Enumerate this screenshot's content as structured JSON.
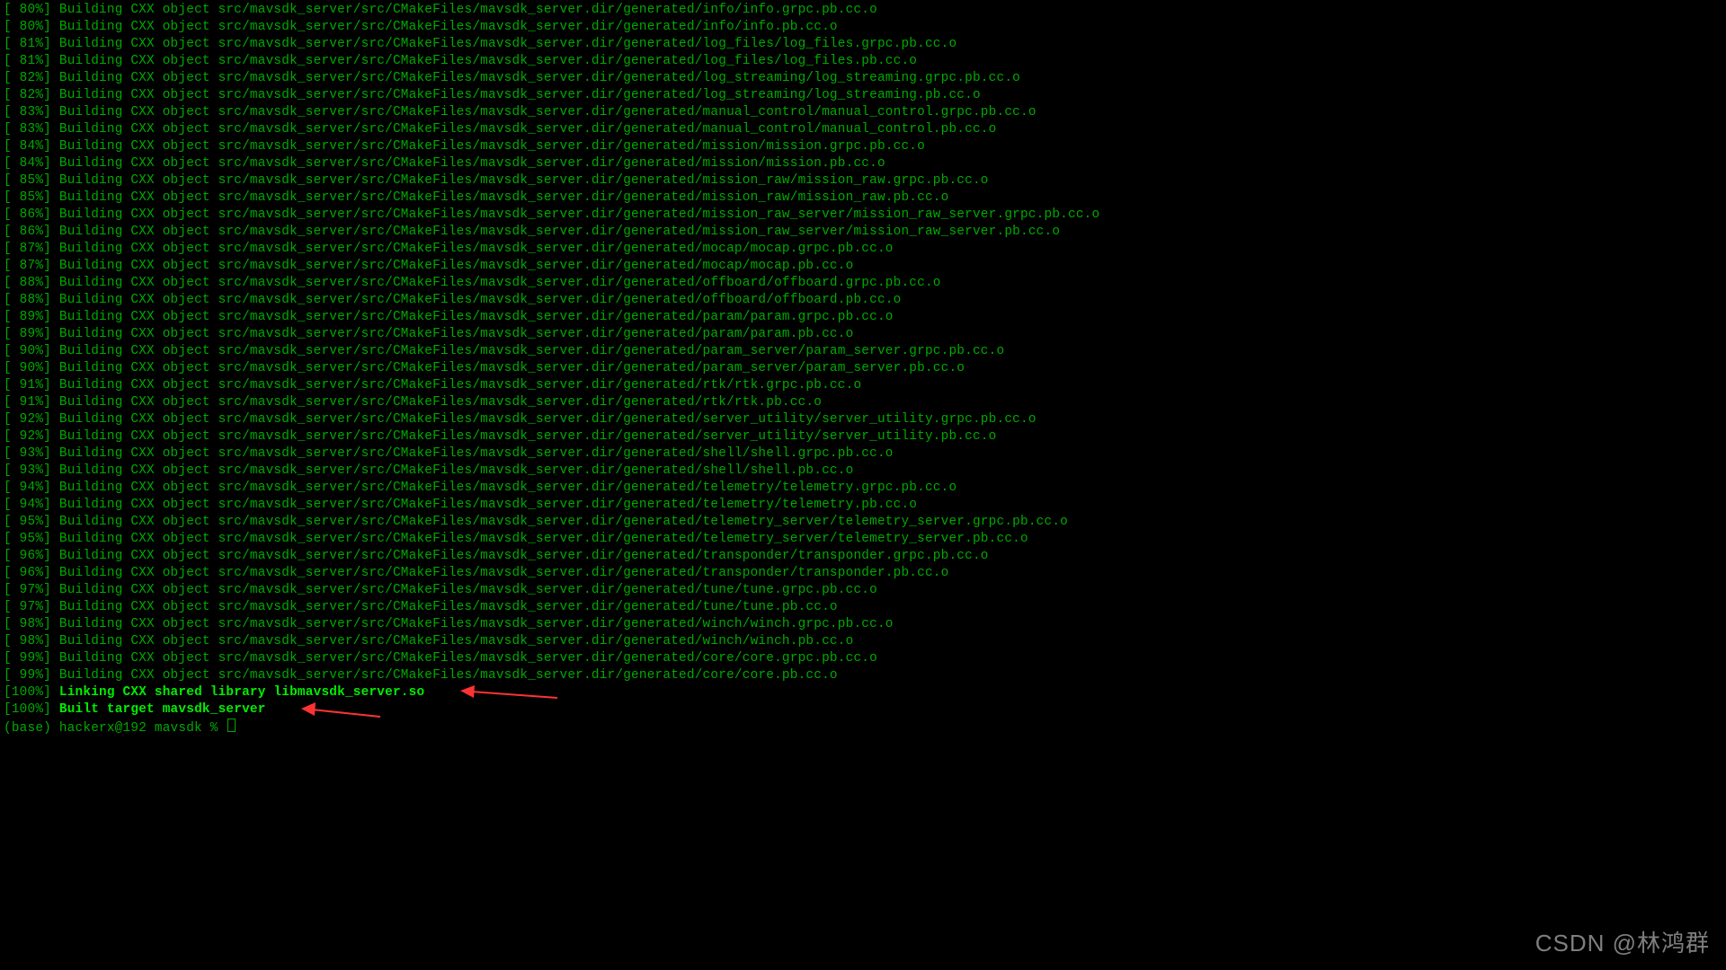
{
  "watermark": "CSDN @林鸿群",
  "prompt": {
    "env": "(base)",
    "user_host": "hackerx@192",
    "cwd": "mavsdk",
    "glyph": "%"
  },
  "path_prefix": "Building CXX object src/mavsdk_server/src/CMakeFiles/mavsdk_server.dir/generated/",
  "lines": [
    {
      "pct": "80%",
      "file": "info/info.grpc.pb.cc.o"
    },
    {
      "pct": "80%",
      "file": "info/info.pb.cc.o"
    },
    {
      "pct": "81%",
      "file": "log_files/log_files.grpc.pb.cc.o"
    },
    {
      "pct": "81%",
      "file": "log_files/log_files.pb.cc.o"
    },
    {
      "pct": "82%",
      "file": "log_streaming/log_streaming.grpc.pb.cc.o"
    },
    {
      "pct": "82%",
      "file": "log_streaming/log_streaming.pb.cc.o"
    },
    {
      "pct": "83%",
      "file": "manual_control/manual_control.grpc.pb.cc.o"
    },
    {
      "pct": "83%",
      "file": "manual_control/manual_control.pb.cc.o"
    },
    {
      "pct": "84%",
      "file": "mission/mission.grpc.pb.cc.o"
    },
    {
      "pct": "84%",
      "file": "mission/mission.pb.cc.o"
    },
    {
      "pct": "85%",
      "file": "mission_raw/mission_raw.grpc.pb.cc.o"
    },
    {
      "pct": "85%",
      "file": "mission_raw/mission_raw.pb.cc.o"
    },
    {
      "pct": "86%",
      "file": "mission_raw_server/mission_raw_server.grpc.pb.cc.o"
    },
    {
      "pct": "86%",
      "file": "mission_raw_server/mission_raw_server.pb.cc.o"
    },
    {
      "pct": "87%",
      "file": "mocap/mocap.grpc.pb.cc.o"
    },
    {
      "pct": "87%",
      "file": "mocap/mocap.pb.cc.o"
    },
    {
      "pct": "88%",
      "file": "offboard/offboard.grpc.pb.cc.o"
    },
    {
      "pct": "88%",
      "file": "offboard/offboard.pb.cc.o"
    },
    {
      "pct": "89%",
      "file": "param/param.grpc.pb.cc.o"
    },
    {
      "pct": "89%",
      "file": "param/param.pb.cc.o"
    },
    {
      "pct": "90%",
      "file": "param_server/param_server.grpc.pb.cc.o"
    },
    {
      "pct": "90%",
      "file": "param_server/param_server.pb.cc.o"
    },
    {
      "pct": "91%",
      "file": "rtk/rtk.grpc.pb.cc.o"
    },
    {
      "pct": "91%",
      "file": "rtk/rtk.pb.cc.o"
    },
    {
      "pct": "92%",
      "file": "server_utility/server_utility.grpc.pb.cc.o"
    },
    {
      "pct": "92%",
      "file": "server_utility/server_utility.pb.cc.o"
    },
    {
      "pct": "93%",
      "file": "shell/shell.grpc.pb.cc.o"
    },
    {
      "pct": "93%",
      "file": "shell/shell.pb.cc.o"
    },
    {
      "pct": "94%",
      "file": "telemetry/telemetry.grpc.pb.cc.o"
    },
    {
      "pct": "94%",
      "file": "telemetry/telemetry.pb.cc.o"
    },
    {
      "pct": "95%",
      "file": "telemetry_server/telemetry_server.grpc.pb.cc.o"
    },
    {
      "pct": "95%",
      "file": "telemetry_server/telemetry_server.pb.cc.o"
    },
    {
      "pct": "96%",
      "file": "transponder/transponder.grpc.pb.cc.o"
    },
    {
      "pct": "96%",
      "file": "transponder/transponder.pb.cc.o"
    },
    {
      "pct": "97%",
      "file": "tune/tune.grpc.pb.cc.o"
    },
    {
      "pct": "97%",
      "file": "tune/tune.pb.cc.o"
    },
    {
      "pct": "98%",
      "file": "winch/winch.grpc.pb.cc.o"
    },
    {
      "pct": "98%",
      "file": "winch/winch.pb.cc.o"
    },
    {
      "pct": "99%",
      "file": "core/core.grpc.pb.cc.o"
    },
    {
      "pct": "99%",
      "file": "core/core.pb.cc.o"
    }
  ],
  "special_lines": [
    {
      "pct": "100%",
      "msg": "Linking CXX shared library libmavsdk_server.so"
    },
    {
      "pct": "100%",
      "msg": "Built target mavsdk_server"
    }
  ]
}
